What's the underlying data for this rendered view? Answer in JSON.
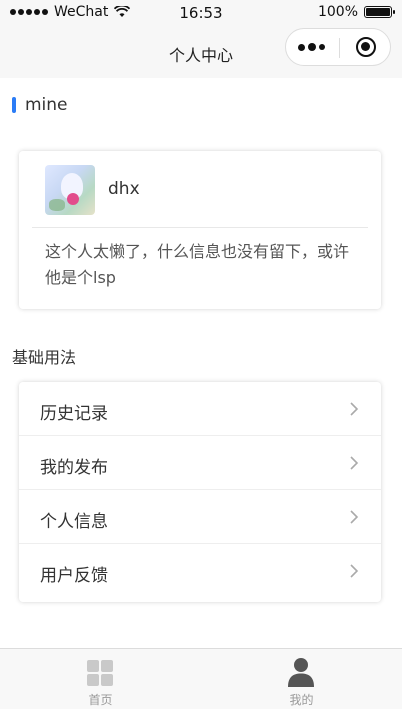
{
  "status_bar": {
    "carrier": "WeChat",
    "time": "16:53",
    "battery": "100%",
    "battery_level": 1.0
  },
  "nav": {
    "title": "个人中心"
  },
  "section": {
    "title": "mine",
    "accent_color": "#2b7cf6"
  },
  "profile": {
    "username": "dhx",
    "bio": "这个人太懒了，什么信息也没有留下，或许他是个lsp"
  },
  "menu": {
    "title": "基础用法",
    "items": [
      {
        "label": "历史记录"
      },
      {
        "label": "我的发布"
      },
      {
        "label": "个人信息"
      },
      {
        "label": "用户反馈"
      }
    ]
  },
  "tab_bar": {
    "tabs": [
      {
        "label": "首页",
        "icon": "grid-icon"
      },
      {
        "label": "我的",
        "icon": "user-icon"
      }
    ]
  }
}
